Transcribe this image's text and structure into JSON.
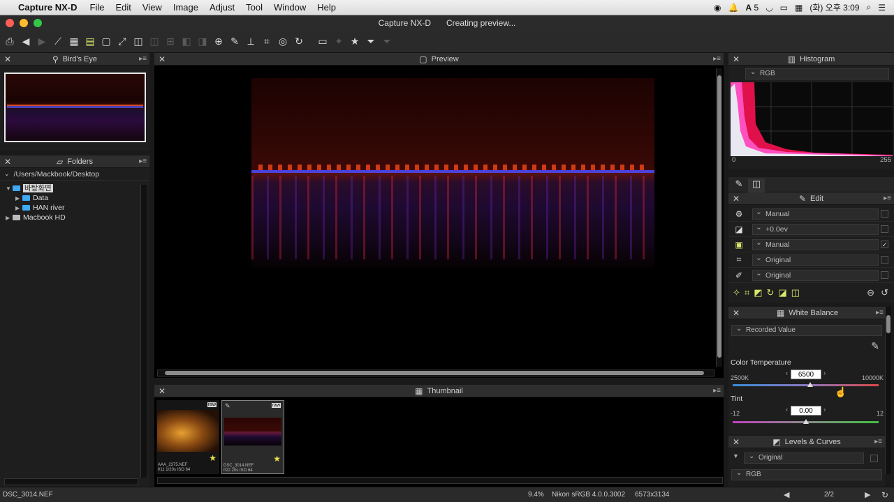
{
  "menubar": {
    "apple": "",
    "app_name": "Capture NX-D",
    "items": [
      "File",
      "Edit",
      "View",
      "Image",
      "Adjust",
      "Tool",
      "Window",
      "Help"
    ],
    "status_right": {
      "badge": "5",
      "time": "(화) 오후 3:09"
    }
  },
  "window": {
    "title": "Capture NX-D",
    "status": "Creating preview..."
  },
  "panels": {
    "birds_eye": {
      "title": "Bird's Eye"
    },
    "folders": {
      "title": "Folders",
      "path": "/Users/Mackbook/Desktop",
      "tree": [
        {
          "label": "바탕화면",
          "level": 0
        },
        {
          "label": "Data",
          "level": 1
        },
        {
          "label": "HAN river",
          "level": 1
        },
        {
          "label": "Macbook HD",
          "level": 0
        }
      ]
    },
    "preview": {
      "title": "Preview"
    },
    "thumbnail": {
      "title": "Thumbnail",
      "items": [
        {
          "name": "AAA_2375.NEF",
          "meta": "f/11 1/20s ISO 64"
        },
        {
          "name": "DSC_3014.NEF",
          "meta": "f/22 20s ISO 64"
        }
      ]
    },
    "histogram": {
      "title": "Histogram",
      "channel": "RGB",
      "min": "0",
      "max": "255"
    },
    "edit": {
      "title": "Edit",
      "rows": [
        {
          "icon": "gear-icon",
          "value": "Manual",
          "checked": false
        },
        {
          "icon": "exposure-icon",
          "value": "+0.0ev",
          "checked": false
        },
        {
          "icon": "picture-control-icon",
          "value": "Manual",
          "checked": true
        },
        {
          "icon": "crop-icon",
          "value": "Original",
          "checked": false
        },
        {
          "icon": "brush-icon",
          "value": "Original",
          "checked": false
        }
      ]
    },
    "white_balance": {
      "title": "White Balance",
      "mode": "Recorded Value",
      "color_temp_label": "Color Temperature",
      "color_temp_value": "6500",
      "color_temp_min": "2500K",
      "color_temp_max": "10000K",
      "color_temp_fraction": 0.53,
      "tint_label": "Tint",
      "tint_value": "0.00",
      "tint_min": "-12",
      "tint_max": "12",
      "tint_fraction": 0.5
    },
    "levels_curves": {
      "title": "Levels & Curves",
      "preset": "Original",
      "channel": "RGB"
    }
  },
  "statusbar": {
    "filename": "DSC_3014.NEF",
    "zoom": "9.4%",
    "profile": "Nikon sRGB 4.0.0.3002",
    "dimensions": "6573x3134",
    "page": "2/2"
  },
  "colors": {
    "accent": "#3fa9f5",
    "panel_bg": "#1e1e1e",
    "header_bg": "#2e2e2e"
  }
}
